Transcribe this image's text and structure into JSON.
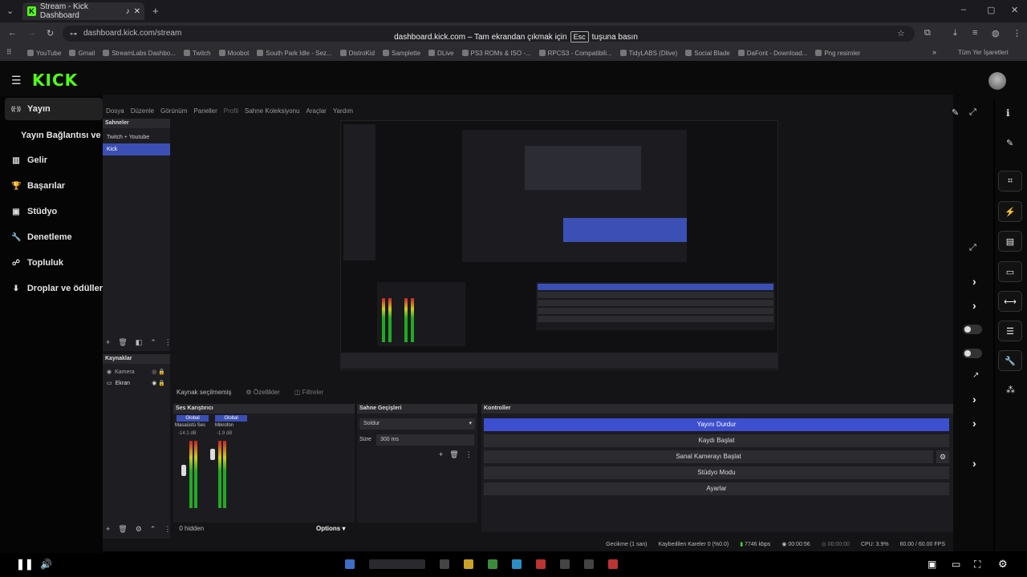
{
  "browser": {
    "tab_title": "Stream - Kick Dashboard",
    "url": "dashboard.kick.com/stream",
    "fullscreen_notice_pre": "dashboard.kick.com – Tam ekrandan çıkmak için",
    "fullscreen_notice_key": "Esc",
    "fullscreen_notice_post": "tuşuna basın",
    "bookmarks": [
      "YouTube",
      "Gmail",
      "StreamLabs Dashbo...",
      "Twitch",
      "Moobot",
      "South Park Idle - Sez...",
      "DistroKid",
      "Samplette",
      "DLive",
      "PS3 ROMs & ISO -...",
      "RPCS3 - Compatibili...",
      "TidyLABS (Dlive)",
      "Social Blade",
      "DaFont - Download...",
      "Png resimler"
    ],
    "all_bookmarks": "Tüm Yer İşaretleri"
  },
  "kick": {
    "logo": "KICK",
    "sidebar": [
      {
        "label": "Yayın",
        "icon": "broadcast-icon"
      },
      {
        "label": "Yayın Bağlantısı ve A",
        "icon": ""
      },
      {
        "label": "Gelir",
        "icon": "revenue-icon"
      },
      {
        "label": "Başarılar",
        "icon": "trophy-icon"
      },
      {
        "label": "Stüdyo",
        "icon": "studio-icon"
      },
      {
        "label": "Denetleme",
        "icon": "wrench-icon"
      },
      {
        "label": "Topluluk",
        "icon": "community-icon"
      },
      {
        "label": "Droplar ve ödüller",
        "icon": "drops-icon"
      }
    ]
  },
  "obs": {
    "menu": [
      "Dosya",
      "Düzenle",
      "Görünüm",
      "Paneller",
      "Profil",
      "Sahne Koleksiyonu",
      "Araçlar",
      "Yardım"
    ],
    "scenes_title": "Sahneler",
    "scenes": [
      "Twitch + Youtube",
      "Kick"
    ],
    "sources_title": "Kaynaklar",
    "sources": [
      "Kamera",
      "Ekran"
    ],
    "no_source": "Kaynak seçilmemiş",
    "properties": "Özellikler",
    "filters": "Filtreler",
    "mixer_title": "Ses Karıştırıcı",
    "mixer_channels": [
      {
        "tag": "Global",
        "name": "Masaüstü Ses",
        "db": "-14.1 dB"
      },
      {
        "tag": "Global",
        "name": "Mikrofon",
        "db": "-1.9 dB"
      }
    ],
    "hidden": "0 hidden",
    "options": "Options",
    "transitions_title": "Sahne Geçişleri",
    "transition": "Soldur",
    "duration_label": "Süre",
    "duration": "300 ms",
    "controls_title": "Kontroller",
    "controls": [
      "Yayını Durdur",
      "Kaydı Başlat",
      "Sanal Kamerayı Başlat",
      "Stüdyo Modu",
      "Ayarlar"
    ],
    "status": {
      "delay": "Gecikme (1 san)",
      "dropped": "Kaybedilen Kareler 0 (%0.0)",
      "bitrate": "7746 kbps",
      "live_time": "00:00:56",
      "rec_time": "00:00:00",
      "cpu": "CPU: 3.9%",
      "fps": "60.00 / 60.00 FPS"
    }
  },
  "colors": {
    "kick_green": "#53fc18",
    "obs_blue": "#3c4fd0"
  }
}
